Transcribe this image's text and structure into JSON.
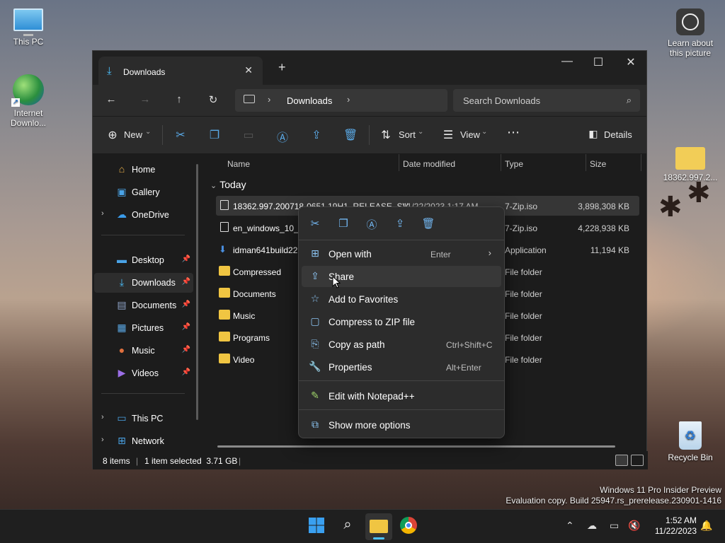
{
  "desktop": {
    "icons": [
      {
        "label_line1": "This PC",
        "label_line2": ""
      },
      {
        "label_line1": "Internet",
        "label_line2": "Downlo..."
      },
      {
        "label_line1": "Learn about",
        "label_line2": "this picture"
      },
      {
        "label_line1": "18362.997.2...",
        "label_line2": ""
      },
      {
        "label_line1": "Recycle Bin",
        "label_line2": ""
      }
    ],
    "watermark": {
      "line1": "Windows 11 Pro Insider Preview",
      "line2": "Evaluation copy. Build 25947.rs_prerelease.230901-1416"
    }
  },
  "window": {
    "tab_title": "Downloads",
    "breadcrumb": "Downloads",
    "search_placeholder": "Search Downloads",
    "commands": {
      "new": "New",
      "sort": "Sort",
      "view": "View",
      "details": "Details"
    }
  },
  "sidebar": {
    "items": [
      {
        "label": "Home"
      },
      {
        "label": "Gallery"
      },
      {
        "label": "OneDrive"
      },
      {
        "label": "Desktop"
      },
      {
        "label": "Downloads"
      },
      {
        "label": "Documents"
      },
      {
        "label": "Pictures"
      },
      {
        "label": "Music"
      },
      {
        "label": "Videos"
      },
      {
        "label": "This PC"
      },
      {
        "label": "Network"
      }
    ]
  },
  "columns": {
    "name": "Name",
    "date": "Date modified",
    "type": "Type",
    "size": "Size"
  },
  "group_label": "Today",
  "files": [
    {
      "name": "18362.997.200718-0651.19H1_RELEASE_SV...",
      "date": "11/22/2023 1:17 AM",
      "type": "7-Zip.iso",
      "size": "3,898,308 KB"
    },
    {
      "name": "en_windows_10_e",
      "date": "",
      "type": "7-Zip.iso",
      "size": "4,228,938 KB"
    },
    {
      "name": "idman641build22",
      "date": "",
      "type": "Application",
      "size": "11,194 KB"
    },
    {
      "name": "Compressed",
      "date": "",
      "type": "File folder",
      "size": ""
    },
    {
      "name": "Documents",
      "date": "",
      "type": "File folder",
      "size": ""
    },
    {
      "name": "Music",
      "date": "",
      "type": "File folder",
      "size": ""
    },
    {
      "name": "Programs",
      "date": "",
      "type": "File folder",
      "size": ""
    },
    {
      "name": "Video",
      "date": "",
      "type": "File folder",
      "size": ""
    }
  ],
  "status": {
    "count": "8 items",
    "selection": "1 item selected  3.71 GB"
  },
  "context_menu": {
    "items": [
      {
        "label": "Open with",
        "shortcut": "Enter"
      },
      {
        "label": "Share",
        "shortcut": ""
      },
      {
        "label": "Add to Favorites",
        "shortcut": ""
      },
      {
        "label": "Compress to ZIP file",
        "shortcut": ""
      },
      {
        "label": "Copy as path",
        "shortcut": "Ctrl+Shift+C"
      },
      {
        "label": "Properties",
        "shortcut": "Alt+Enter"
      },
      {
        "label": "Edit with Notepad++",
        "shortcut": ""
      },
      {
        "label": "Show more options",
        "shortcut": ""
      }
    ]
  },
  "taskbar": {
    "time": "1:52 AM",
    "date": "11/22/2023"
  }
}
